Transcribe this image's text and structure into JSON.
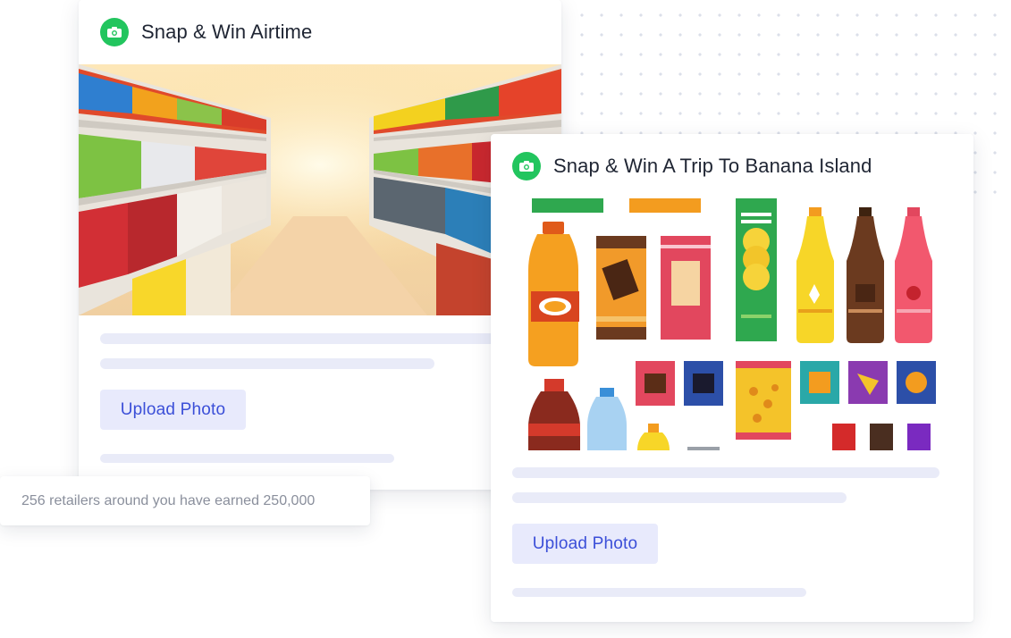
{
  "cards": [
    {
      "title": "Snap & Win Airtime",
      "icon": "camera-icon",
      "button_label": "Upload Photo",
      "image": "supermarket-aisle-image"
    },
    {
      "title": "Snap & Win A Trip To Banana Island",
      "icon": "camera-icon",
      "button_label": "Upload Photo",
      "image": "snack-products-image"
    }
  ],
  "toast": {
    "text": "256 retailers around you have earned 250,000"
  },
  "colors": {
    "accent_green": "#22c55e",
    "button_bg": "#e8eafc",
    "button_text": "#3b4fd8",
    "skeleton_line": "#e9ebf8"
  }
}
